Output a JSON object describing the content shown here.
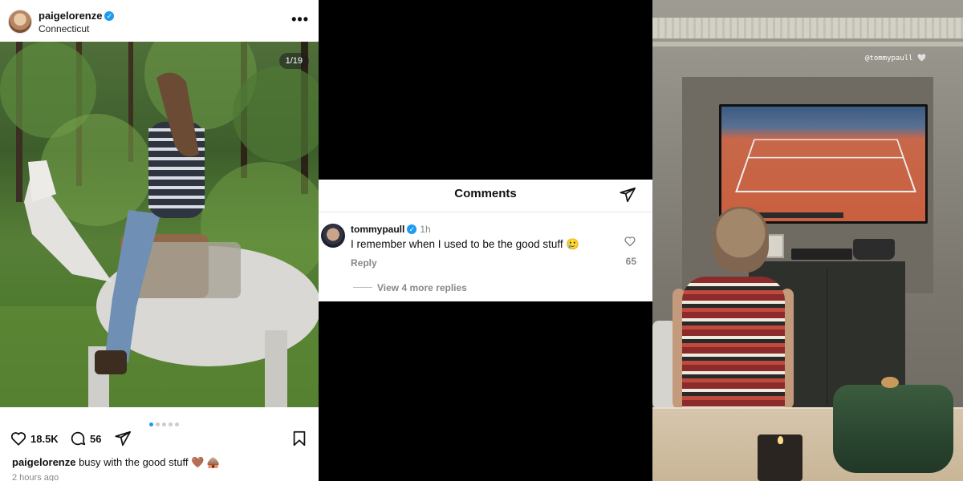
{
  "post": {
    "username": "paigelorenze",
    "verified_mark": "✓",
    "location": "Connecticut",
    "more_label": "•••",
    "photo_counter": "1/19",
    "carousel": {
      "total_dots": 5,
      "active_dot": 1
    },
    "likes": "18.5K",
    "comments": "56",
    "caption_user": "paigelorenze",
    "caption_text": " busy with the good stuff 🤎 🛖",
    "time_ago": "2 hours ago",
    "icons": {
      "like": "heart-icon",
      "comment": "comment-icon",
      "share": "send-icon",
      "save": "bookmark-icon"
    }
  },
  "comments_panel": {
    "title": "Comments",
    "comment": {
      "user": "tommypaull",
      "time": "1h",
      "text": "I remember when I used to be the good stuff 🥲",
      "reply_label": "Reply",
      "likes": "65"
    },
    "more_replies": "View 4 more replies"
  },
  "story": {
    "tag": "@tommypaull 🤍"
  },
  "colors": {
    "verified": "#1d9bf0",
    "accent_dot": "#1d9bf0",
    "muted_text": "#888888"
  }
}
